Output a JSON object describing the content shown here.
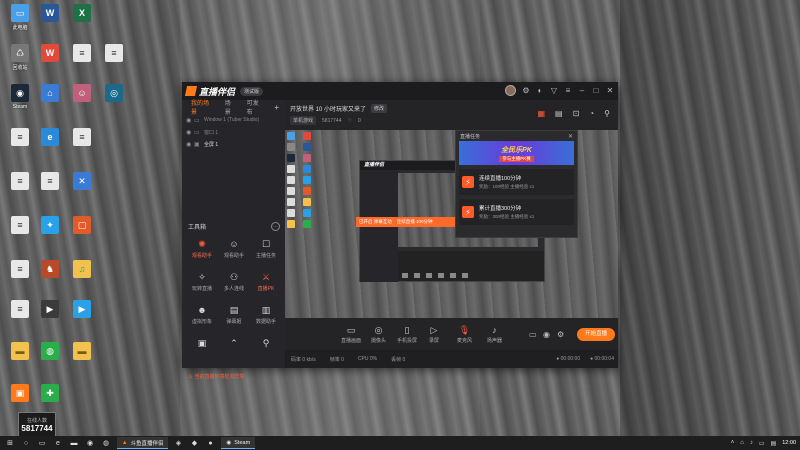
{
  "colors": {
    "accent": "#ff7a1a",
    "danger": "#ff5a3a",
    "window_bg": "#242427",
    "titlebar_bg": "#1c1c1f"
  },
  "desktop": {
    "icons": [
      {
        "label": "此电脑",
        "icon": "computer-icon",
        "color": "#4aa0e8"
      },
      {
        "label": "回收站",
        "icon": "recycle-bin-icon",
        "color": "#888888"
      },
      {
        "label": "Steam",
        "icon": "steam-icon",
        "color": "#1b2838"
      },
      {
        "label": "",
        "icon": "document-icon",
        "color": "#dddddd"
      },
      {
        "label": "",
        "icon": "document-icon",
        "color": "#dddddd"
      },
      {
        "label": "",
        "icon": "document-icon",
        "color": "#dddddd"
      },
      {
        "label": "",
        "icon": "document-icon",
        "color": "#dddddd"
      },
      {
        "label": "",
        "icon": "document-icon",
        "color": "#dddddd"
      },
      {
        "label": "",
        "icon": "document-icon",
        "color": "#dddddd"
      }
    ],
    "viewer_count_label": "在线人数",
    "viewer_count": "5817744"
  },
  "app": {
    "name": "直播伴侣",
    "version_pill": "测试版",
    "left_tabs": [
      "我的场景",
      "场景",
      "可发布"
    ],
    "sources": [
      {
        "label": "Window 1 (Tuber Studio)",
        "active": false
      },
      {
        "label": "窗口 1",
        "active": false
      },
      {
        "label": "全屏 1",
        "active": true
      }
    ],
    "tools_title": "工具箱",
    "tools": [
      {
        "label": "观看助手",
        "icon": "sparkle-icon",
        "red": true
      },
      {
        "label": "观看助手",
        "icon": "person-icon",
        "red": false
      },
      {
        "label": "主播任务",
        "icon": "task-icon",
        "red": false
      },
      {
        "label": "玩转直播",
        "icon": "lightbulb-icon",
        "red": false
      },
      {
        "label": "多人连线",
        "icon": "people-icon",
        "red": false
      },
      {
        "label": "直播PK",
        "icon": "pk-icon",
        "red": true
      },
      {
        "label": "虚拟形象",
        "icon": "mask-icon",
        "red": false
      },
      {
        "label": "弹幕姬",
        "icon": "chat-icon",
        "red": false
      },
      {
        "label": "数据助手",
        "icon": "chart-icon",
        "red": false
      },
      {
        "label": "",
        "icon": "gift-icon",
        "red": false
      },
      {
        "label": "",
        "icon": "arrow-icon",
        "red": false
      },
      {
        "label": "",
        "icon": "share-icon",
        "red": false
      }
    ],
    "left_warning": "当前直播环境检测异常",
    "stream_title": "开放世界 10 小时玩家又来了",
    "stream_edit": "修改",
    "stream_category": "单机游戏",
    "stream_room": "5817744",
    "stream_likes": "0",
    "popup": {
      "title": "直播任务",
      "banner_title": "全民乐PK",
      "banner_sub": "参与主播PK赛",
      "tasks": [
        {
          "name": "连续直播100分钟",
          "desc": "奖励：100经验 主播经验 x1"
        },
        {
          "name": "累计直播300分钟",
          "desc": "奖励：300经验 主播经验 x1"
        }
      ]
    },
    "nested_bar_items": [
      "已开启 弹幕互动",
      "连续直播 100分钟"
    ],
    "controls": [
      {
        "label": "直播画面",
        "icon": "screen-icon",
        "red": false
      },
      {
        "label": "摄像头",
        "icon": "camera-icon",
        "red": false
      },
      {
        "label": "手机投屏",
        "icon": "phone-icon",
        "red": false
      },
      {
        "label": "录屏",
        "icon": "record-icon",
        "red": false
      },
      {
        "label": "麦克风",
        "icon": "mic-icon",
        "red": true
      },
      {
        "label": "扬声器",
        "icon": "speaker-icon",
        "red": false
      }
    ],
    "live_button": "开始直播",
    "status": {
      "bitrate": "码率 0 kb/s",
      "fps": "帧率 0",
      "cpu": "CPU 0%",
      "loss": "丢帧 0",
      "time_live": "00:00:00",
      "time_rec": "00:00:04"
    }
  },
  "taskbar": {
    "tasks": [
      {
        "label": "斗鱼直播伴侣",
        "icon": "live-app-icon"
      },
      {
        "label": "Steam",
        "icon": "steam-icon"
      }
    ],
    "clock": "12:00"
  }
}
